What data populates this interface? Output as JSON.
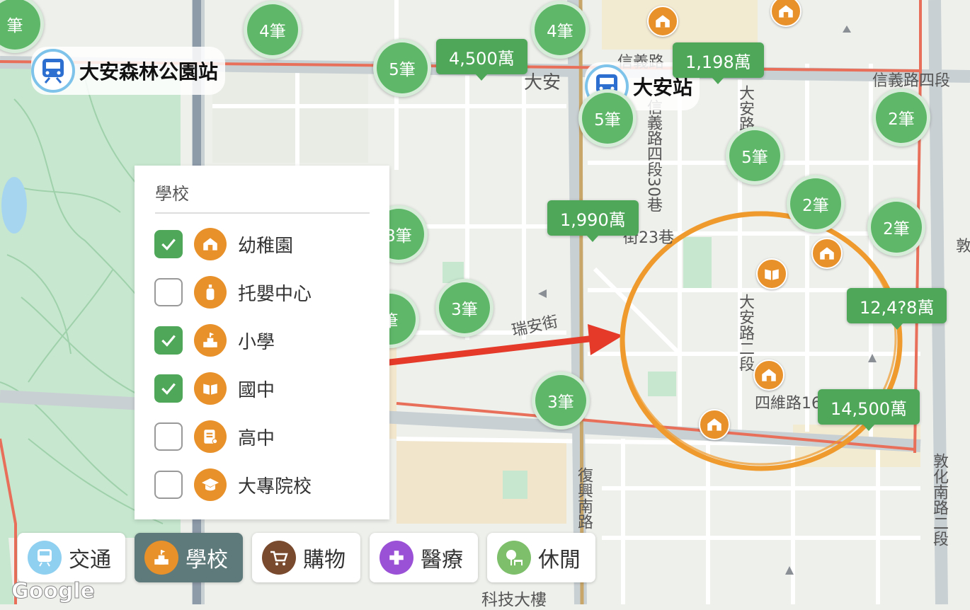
{
  "map": {
    "stations": [
      {
        "name": "大安森林公園站"
      },
      {
        "name": "大安站"
      }
    ],
    "clusters": [
      "4筆",
      "4筆",
      "5筆",
      "5筆",
      "5筆",
      "2筆",
      "2筆",
      "2筆",
      "3筆",
      "3筆",
      "3筆",
      "筆",
      "筆"
    ],
    "price_tags": [
      "4,500萬",
      "1,198萬",
      "1,990萬",
      "12,4?8萬",
      "14,500萬"
    ],
    "street_labels": {
      "xinyi_road": "信義路",
      "xinyi_road_4": "信義路四段",
      "daan_top": "大安",
      "daan_road": "大安路",
      "daan_road_2": "大安路二段",
      "ruian_street": "瑞安街",
      "siwei_road": "四維路16",
      "fuxing_s_road": "復興南路",
      "dunhua_s_road_2": "敦化南路二段",
      "xinyi_lane": "信義路四段30巷",
      "lane_23": "街23巷",
      "keji_building": "科技大樓",
      "dun": "敦"
    },
    "colors": {
      "cluster": "#5fb86a",
      "price_tag": "#4fa85a",
      "poi": "#e8912a",
      "arrow": "#e53a2a",
      "circle": "#ef9a2c",
      "boundary": "#e8705a"
    }
  },
  "filter_panel": {
    "title": "學校",
    "options": [
      {
        "label": "幼稚園",
        "checked": true,
        "icon": "kindergarten-icon"
      },
      {
        "label": "托嬰中心",
        "checked": false,
        "icon": "nursery-bottle-icon"
      },
      {
        "label": "小學",
        "checked": true,
        "icon": "elementary-school-icon"
      },
      {
        "label": "國中",
        "checked": true,
        "icon": "book-icon"
      },
      {
        "label": "高中",
        "checked": false,
        "icon": "certificate-icon"
      },
      {
        "label": "大專院校",
        "checked": false,
        "icon": "graduation-cap-icon"
      }
    ]
  },
  "tabs": [
    {
      "label": "交通",
      "icon": "transit-icon",
      "active": false
    },
    {
      "label": "學校",
      "icon": "school-icon",
      "active": true
    },
    {
      "label": "購物",
      "icon": "cart-icon",
      "active": false
    },
    {
      "label": "醫療",
      "icon": "medical-cross-icon",
      "active": false
    },
    {
      "label": "休閒",
      "icon": "tree-bench-icon",
      "active": false
    }
  ],
  "google_logo": "Google"
}
